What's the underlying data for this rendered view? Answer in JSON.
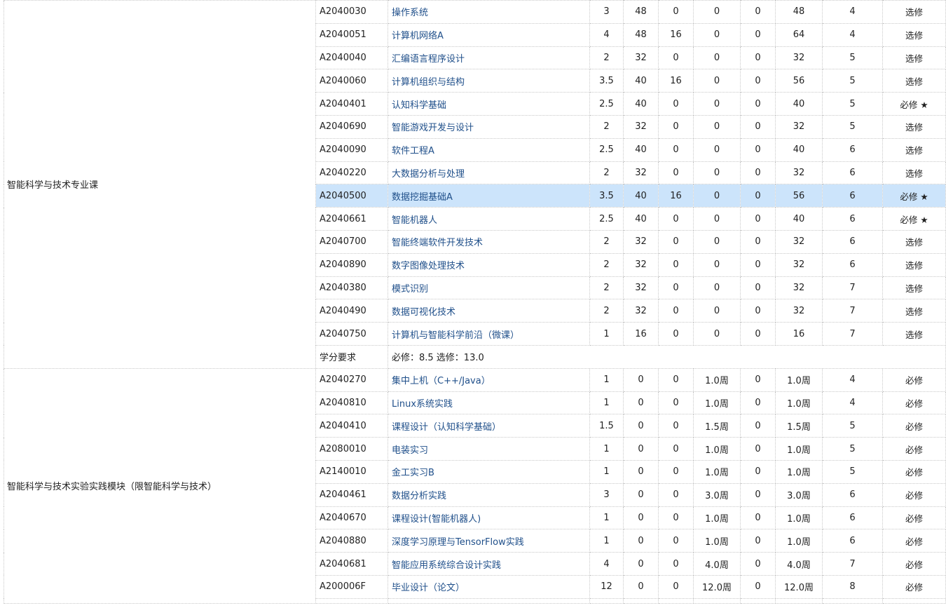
{
  "modules": [
    {
      "name": "智能科学与技术专业课",
      "courses": [
        {
          "code": "A2040030",
          "name": "操作系统",
          "credits": "3",
          "lecture": "48",
          "lab": "0",
          "practice": "0",
          "other": "0",
          "total": "48",
          "term": "4",
          "type": "选修"
        },
        {
          "code": "A2040051",
          "name": "计算机网络A",
          "credits": "4",
          "lecture": "48",
          "lab": "16",
          "practice": "0",
          "other": "0",
          "total": "64",
          "term": "4",
          "type": "选修"
        },
        {
          "code": "A2040040",
          "name": "汇编语言程序设计",
          "credits": "2",
          "lecture": "32",
          "lab": "0",
          "practice": "0",
          "other": "0",
          "total": "32",
          "term": "5",
          "type": "选修"
        },
        {
          "code": "A2040060",
          "name": "计算机组织与结构",
          "credits": "3.5",
          "lecture": "40",
          "lab": "16",
          "practice": "0",
          "other": "0",
          "total": "56",
          "term": "5",
          "type": "选修"
        },
        {
          "code": "A2040401",
          "name": "认知科学基础",
          "credits": "2.5",
          "lecture": "40",
          "lab": "0",
          "practice": "0",
          "other": "0",
          "total": "40",
          "term": "5",
          "type": "必修 ★"
        },
        {
          "code": "A2040690",
          "name": "智能游戏开发与设计",
          "credits": "2",
          "lecture": "32",
          "lab": "0",
          "practice": "0",
          "other": "0",
          "total": "32",
          "term": "5",
          "type": "选修"
        },
        {
          "code": "A2040090",
          "name": "软件工程A",
          "credits": "2.5",
          "lecture": "40",
          "lab": "0",
          "practice": "0",
          "other": "0",
          "total": "40",
          "term": "6",
          "type": "选修"
        },
        {
          "code": "A2040220",
          "name": "大数据分析与处理",
          "credits": "2",
          "lecture": "32",
          "lab": "0",
          "practice": "0",
          "other": "0",
          "total": "32",
          "term": "6",
          "type": "选修"
        },
        {
          "code": "A2040500",
          "name": "数据挖掘基础A",
          "credits": "3.5",
          "lecture": "40",
          "lab": "16",
          "practice": "0",
          "other": "0",
          "total": "56",
          "term": "6",
          "type": "必修 ★",
          "highlight": true
        },
        {
          "code": "A2040661",
          "name": "智能机器人",
          "credits": "2.5",
          "lecture": "40",
          "lab": "0",
          "practice": "0",
          "other": "0",
          "total": "40",
          "term": "6",
          "type": "必修 ★"
        },
        {
          "code": "A2040700",
          "name": "智能终端软件开发技术",
          "credits": "2",
          "lecture": "32",
          "lab": "0",
          "practice": "0",
          "other": "0",
          "total": "32",
          "term": "6",
          "type": "选修"
        },
        {
          "code": "A2040890",
          "name": "数字图像处理技术",
          "credits": "2",
          "lecture": "32",
          "lab": "0",
          "practice": "0",
          "other": "0",
          "total": "32",
          "term": "6",
          "type": "选修"
        },
        {
          "code": "A2040380",
          "name": "模式识别",
          "credits": "2",
          "lecture": "32",
          "lab": "0",
          "practice": "0",
          "other": "0",
          "total": "32",
          "term": "7",
          "type": "选修"
        },
        {
          "code": "A2040490",
          "name": "数据可视化技术",
          "credits": "2",
          "lecture": "32",
          "lab": "0",
          "practice": "0",
          "other": "0",
          "total": "32",
          "term": "7",
          "type": "选修"
        },
        {
          "code": "A2040750",
          "name": "计算机与智能科学前沿（微课）",
          "credits": "1",
          "lecture": "16",
          "lab": "0",
          "practice": "0",
          "other": "0",
          "total": "16",
          "term": "7",
          "type": "选修"
        }
      ],
      "requirement_label": "学分要求",
      "requirement_text": "必修：8.5 选修：13.0"
    },
    {
      "name": "智能科学与技术实验实践模块（限智能科学与技术）",
      "courses": [
        {
          "code": "A2040270",
          "name": "集中上机（C++/Java）",
          "credits": "1",
          "lecture": "0",
          "lab": "0",
          "practice": "1.0周",
          "other": "0",
          "total": "1.0周",
          "term": "4",
          "type": "必修"
        },
        {
          "code": "A2040810",
          "name": "Linux系统实践",
          "credits": "1",
          "lecture": "0",
          "lab": "0",
          "practice": "1.0周",
          "other": "0",
          "total": "1.0周",
          "term": "4",
          "type": "必修"
        },
        {
          "code": "A2040410",
          "name": "课程设计（认知科学基础）",
          "credits": "1.5",
          "lecture": "0",
          "lab": "0",
          "practice": "1.5周",
          "other": "0",
          "total": "1.5周",
          "term": "5",
          "type": "必修"
        },
        {
          "code": "A2080010",
          "name": "电装实习",
          "credits": "1",
          "lecture": "0",
          "lab": "0",
          "practice": "1.0周",
          "other": "0",
          "total": "1.0周",
          "term": "5",
          "type": "必修"
        },
        {
          "code": "A2140010",
          "name": "金工实习B",
          "credits": "1",
          "lecture": "0",
          "lab": "0",
          "practice": "1.0周",
          "other": "0",
          "total": "1.0周",
          "term": "5",
          "type": "必修"
        },
        {
          "code": "A2040461",
          "name": "数据分析实践",
          "credits": "3",
          "lecture": "0",
          "lab": "0",
          "practice": "3.0周",
          "other": "0",
          "total": "3.0周",
          "term": "6",
          "type": "必修"
        },
        {
          "code": "A2040670",
          "name": "课程设计(智能机器人)",
          "credits": "1",
          "lecture": "0",
          "lab": "0",
          "practice": "1.0周",
          "other": "0",
          "total": "1.0周",
          "term": "6",
          "type": "必修"
        },
        {
          "code": "A2040880",
          "name": "深度学习原理与TensorFlow实践",
          "credits": "1",
          "lecture": "0",
          "lab": "0",
          "practice": "1.0周",
          "other": "0",
          "total": "1.0周",
          "term": "6",
          "type": "必修"
        },
        {
          "code": "A2040681",
          "name": "智能应用系统综合设计实践",
          "credits": "4",
          "lecture": "0",
          "lab": "0",
          "practice": "4.0周",
          "other": "0",
          "total": "4.0周",
          "term": "7",
          "type": "必修"
        },
        {
          "code": "A200006F",
          "name": "毕业设计（论文）",
          "credits": "12",
          "lecture": "0",
          "lab": "0",
          "practice": "12.0周",
          "other": "0",
          "total": "12.0周",
          "term": "8",
          "type": "必修"
        }
      ]
    }
  ]
}
